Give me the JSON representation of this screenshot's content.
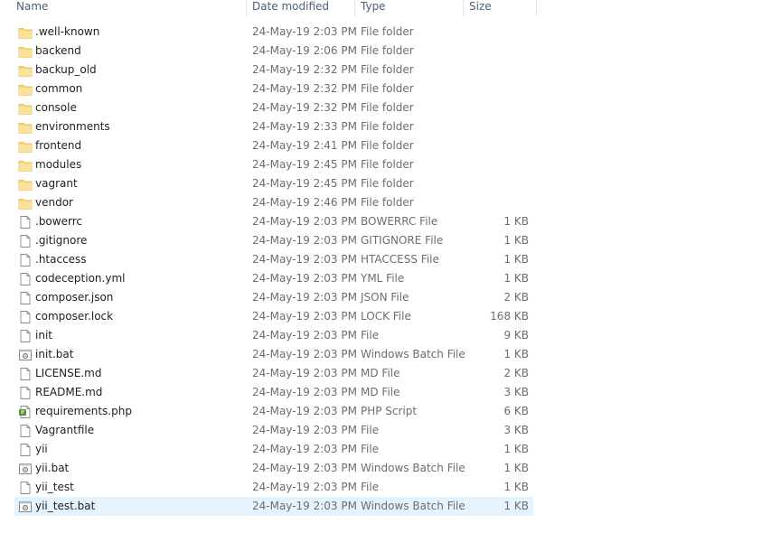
{
  "columns": {
    "name": "Name",
    "date": "Date modified",
    "type": "Type",
    "size": "Size"
  },
  "colors": {
    "folder": "#f8d775",
    "header_text": "#4c607a",
    "selected_row": "#e5f3ff"
  },
  "files": [
    {
      "name": ".well-known",
      "date": "24-May-19 2:03 PM",
      "type": "File folder",
      "size": "",
      "icon": "folder-icon"
    },
    {
      "name": "backend",
      "date": "24-May-19 2:06 PM",
      "type": "File folder",
      "size": "",
      "icon": "folder-icon"
    },
    {
      "name": "backup_old",
      "date": "24-May-19 2:32 PM",
      "type": "File folder",
      "size": "",
      "icon": "folder-icon"
    },
    {
      "name": "common",
      "date": "24-May-19 2:32 PM",
      "type": "File folder",
      "size": "",
      "icon": "folder-icon"
    },
    {
      "name": "console",
      "date": "24-May-19 2:32 PM",
      "type": "File folder",
      "size": "",
      "icon": "folder-icon"
    },
    {
      "name": "environments",
      "date": "24-May-19 2:33 PM",
      "type": "File folder",
      "size": "",
      "icon": "folder-icon"
    },
    {
      "name": "frontend",
      "date": "24-May-19 2:41 PM",
      "type": "File folder",
      "size": "",
      "icon": "folder-icon"
    },
    {
      "name": "modules",
      "date": "24-May-19 2:45 PM",
      "type": "File folder",
      "size": "",
      "icon": "folder-icon"
    },
    {
      "name": "vagrant",
      "date": "24-May-19 2:45 PM",
      "type": "File folder",
      "size": "",
      "icon": "folder-icon"
    },
    {
      "name": "vendor",
      "date": "24-May-19 2:46 PM",
      "type": "File folder",
      "size": "",
      "icon": "folder-icon"
    },
    {
      "name": ".bowerrc",
      "date": "24-May-19 2:03 PM",
      "type": "BOWERRC File",
      "size": "1 KB",
      "icon": "file-icon"
    },
    {
      "name": ".gitignore",
      "date": "24-May-19 2:03 PM",
      "type": "GITIGNORE File",
      "size": "1 KB",
      "icon": "file-icon"
    },
    {
      "name": ".htaccess",
      "date": "24-May-19 2:03 PM",
      "type": "HTACCESS File",
      "size": "1 KB",
      "icon": "file-icon"
    },
    {
      "name": "codeception.yml",
      "date": "24-May-19 2:03 PM",
      "type": "YML File",
      "size": "1 KB",
      "icon": "file-icon"
    },
    {
      "name": "composer.json",
      "date": "24-May-19 2:03 PM",
      "type": "JSON File",
      "size": "2 KB",
      "icon": "file-icon"
    },
    {
      "name": "composer.lock",
      "date": "24-May-19 2:03 PM",
      "type": "LOCK File",
      "size": "168 KB",
      "icon": "file-icon"
    },
    {
      "name": "init",
      "date": "24-May-19 2:03 PM",
      "type": "File",
      "size": "9 KB",
      "icon": "file-icon"
    },
    {
      "name": "init.bat",
      "date": "24-May-19 2:03 PM",
      "type": "Windows Batch File",
      "size": "1 KB",
      "icon": "batch-file-icon"
    },
    {
      "name": "LICENSE.md",
      "date": "24-May-19 2:03 PM",
      "type": "MD File",
      "size": "2 KB",
      "icon": "file-icon"
    },
    {
      "name": "README.md",
      "date": "24-May-19 2:03 PM",
      "type": "MD File",
      "size": "3 KB",
      "icon": "file-icon"
    },
    {
      "name": "requirements.php",
      "date": "24-May-19 2:03 PM",
      "type": "PHP Script",
      "size": "6 KB",
      "icon": "php-file-icon"
    },
    {
      "name": "Vagrantfile",
      "date": "24-May-19 2:03 PM",
      "type": "File",
      "size": "3 KB",
      "icon": "file-icon"
    },
    {
      "name": "yii",
      "date": "24-May-19 2:03 PM",
      "type": "File",
      "size": "1 KB",
      "icon": "file-icon"
    },
    {
      "name": "yii.bat",
      "date": "24-May-19 2:03 PM",
      "type": "Windows Batch File",
      "size": "1 KB",
      "icon": "batch-file-icon"
    },
    {
      "name": "yii_test",
      "date": "24-May-19 2:03 PM",
      "type": "File",
      "size": "1 KB",
      "icon": "file-icon"
    },
    {
      "name": "yii_test.bat",
      "date": "24-May-19 2:03 PM",
      "type": "Windows Batch File",
      "size": "1 KB",
      "icon": "batch-file-icon",
      "selected": true
    }
  ]
}
